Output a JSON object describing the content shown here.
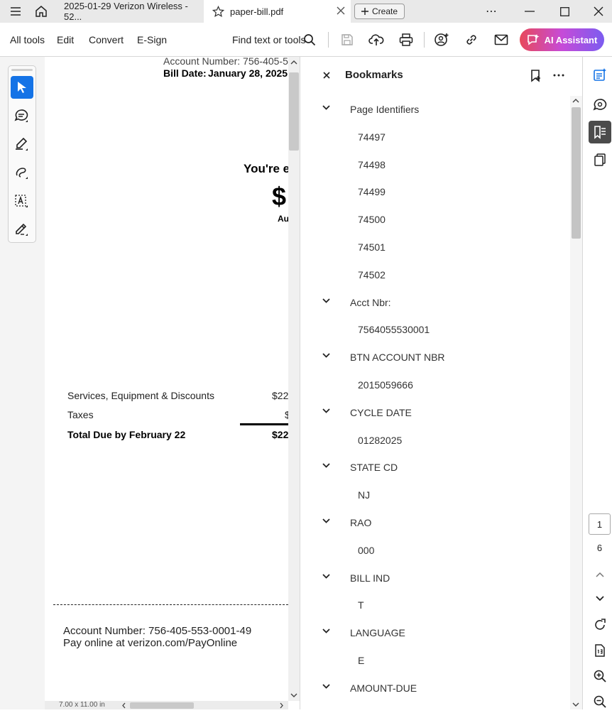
{
  "titlebar": {
    "tab1_title": "2025-01-29 Verizon Wireless - 52...",
    "tab2_title": "paper-bill.pdf",
    "create_label": "Create",
    "more_label": "⋯"
  },
  "menubar": {
    "items": [
      "All tools",
      "Edit",
      "Convert",
      "E-Sign"
    ],
    "find_label": "Find text or tools",
    "ai_label": "AI Assistant"
  },
  "document": {
    "account_number_top": "Account Number:   756-405-5",
    "bill_date_label": "Bill Date:",
    "bill_date_value": "January 28, 2025",
    "youre": "You're e",
    "dollar": "$",
    "au": "Au",
    "rows": [
      {
        "label": "Services, Equipment & Discounts",
        "value": "$22"
      },
      {
        "label": "Taxes",
        "value": "$"
      },
      {
        "label": "Total Due by February 22",
        "value": "$22"
      }
    ],
    "footer_account": "Account Number: 756-405-553-0001-49",
    "footer_pay": "Pay online at verizon.com/PayOnline",
    "page_size": "7.00 x 11.00 in"
  },
  "bookmarks": {
    "title": "Bookmarks",
    "items": [
      {
        "label": "Page Identifiers",
        "level": 0
      },
      {
        "label": "74497",
        "level": 1
      },
      {
        "label": "74498",
        "level": 1
      },
      {
        "label": "74499",
        "level": 1
      },
      {
        "label": "74500",
        "level": 1
      },
      {
        "label": "74501",
        "level": 1
      },
      {
        "label": "74502",
        "level": 1
      },
      {
        "label": "Acct Nbr:",
        "level": 0
      },
      {
        "label": "7564055530001",
        "level": 1
      },
      {
        "label": "BTN ACCOUNT NBR",
        "level": 0
      },
      {
        "label": "2015059666",
        "level": 1
      },
      {
        "label": "CYCLE DATE",
        "level": 0
      },
      {
        "label": "01282025",
        "level": 1
      },
      {
        "label": "STATE CD",
        "level": 0
      },
      {
        "label": "NJ",
        "level": 1
      },
      {
        "label": "RAO",
        "level": 0
      },
      {
        "label": "000",
        "level": 1
      },
      {
        "label": "BILL IND",
        "level": 0
      },
      {
        "label": "T",
        "level": 1
      },
      {
        "label": "LANGUAGE",
        "level": 0
      },
      {
        "label": "E",
        "level": 1
      },
      {
        "label": "AMOUNT-DUE",
        "level": 0
      }
    ]
  },
  "pagination": {
    "current": "1",
    "total": "6"
  },
  "colors": {
    "accent": "#1473e6",
    "ai_gradient_start": "#e8495a",
    "ai_gradient_end": "#7b5cf0"
  }
}
